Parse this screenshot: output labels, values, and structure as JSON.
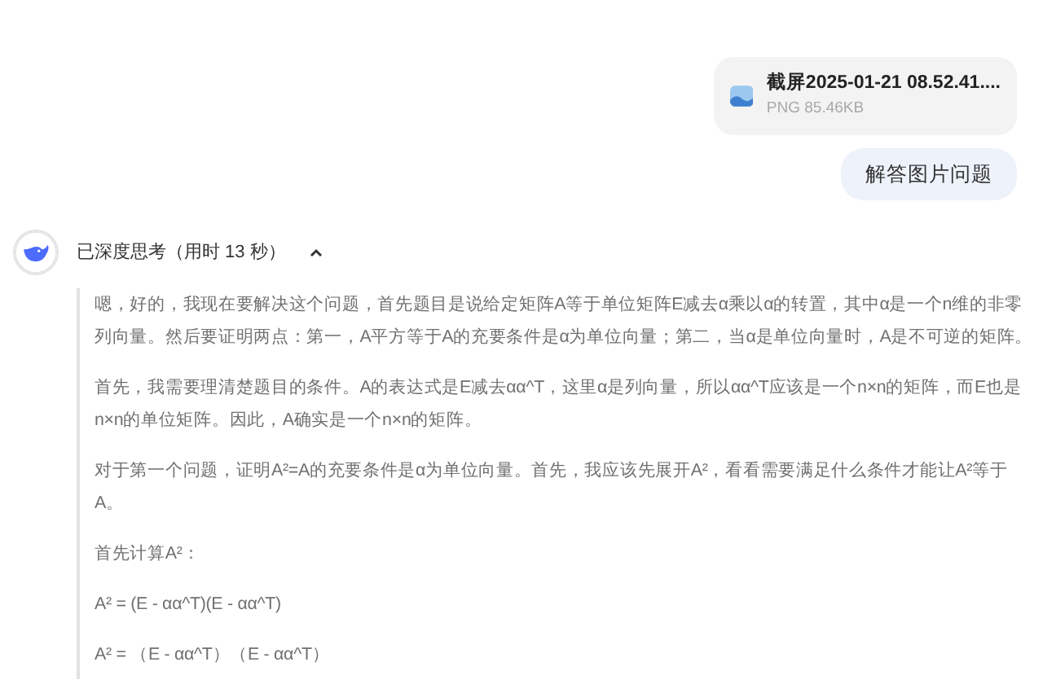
{
  "attachment": {
    "name": "截屏2025-01-21 08.52.41....",
    "meta": "PNG 85.46KB"
  },
  "user_message": "解答图片问题",
  "thinking": {
    "title": "已深度思考（用时 13 秒）",
    "expanded": true,
    "paragraphs": [
      "嗯，好的，我现在要解决这个问题，首先题目是说给定矩阵A等于单位矩阵E减去α乘以α的转置，其中α是一个n维的非零列向量。然后要证明两点：第一，A平方等于A的充要条件是α为单位向量；第二，当α是单位向量时，A是不可逆的矩阵。",
      "首先，我需要理清楚题目的条件。A的表达式是E减去αα^T，这里α是列向量，所以αα^T应该是一个n×n的矩阵，而E也是n×n的单位矩阵。因此，A确实是一个n×n的矩阵。",
      "对于第一个问题，证明A²=A的充要条件是α为单位向量。首先，我应该先展开A²，看看需要满足什么条件才能让A²等于A。",
      "首先计算A²：",
      "A² = (E - αα^T)(E - αα^T)",
      "A² = （E - αα^T）（E - αα^T）"
    ]
  }
}
